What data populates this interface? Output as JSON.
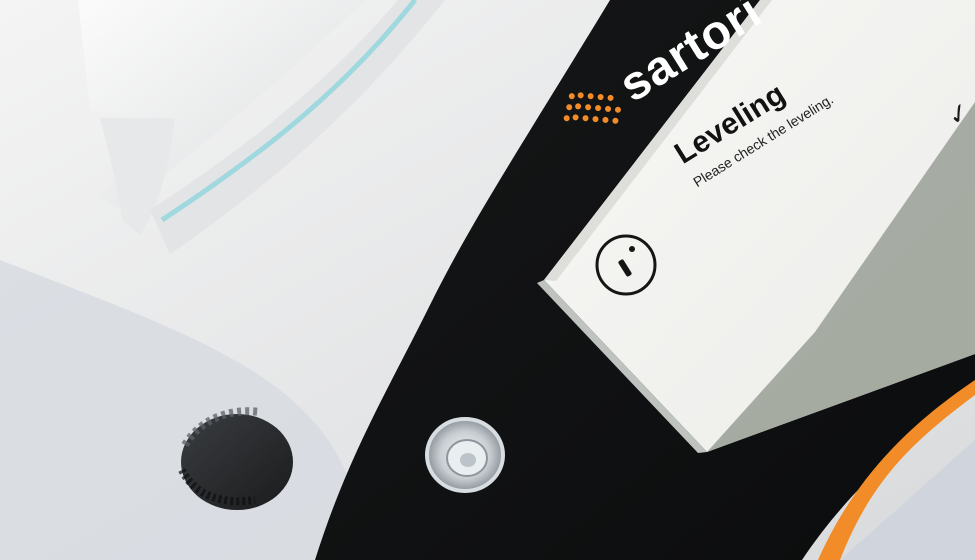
{
  "brand": {
    "name": "sartori",
    "logo_name": "sartorius-dot-logo"
  },
  "dialog": {
    "title": "Leveling",
    "message": "Please check the leveling.",
    "icon": "info-icon",
    "confirm_icon": "checkmark-icon"
  },
  "colors": {
    "accent_orange": "#f28c28",
    "panel_black": "#101112",
    "screen_white": "#f3f3f1",
    "screen_bar": "#9da39a"
  }
}
